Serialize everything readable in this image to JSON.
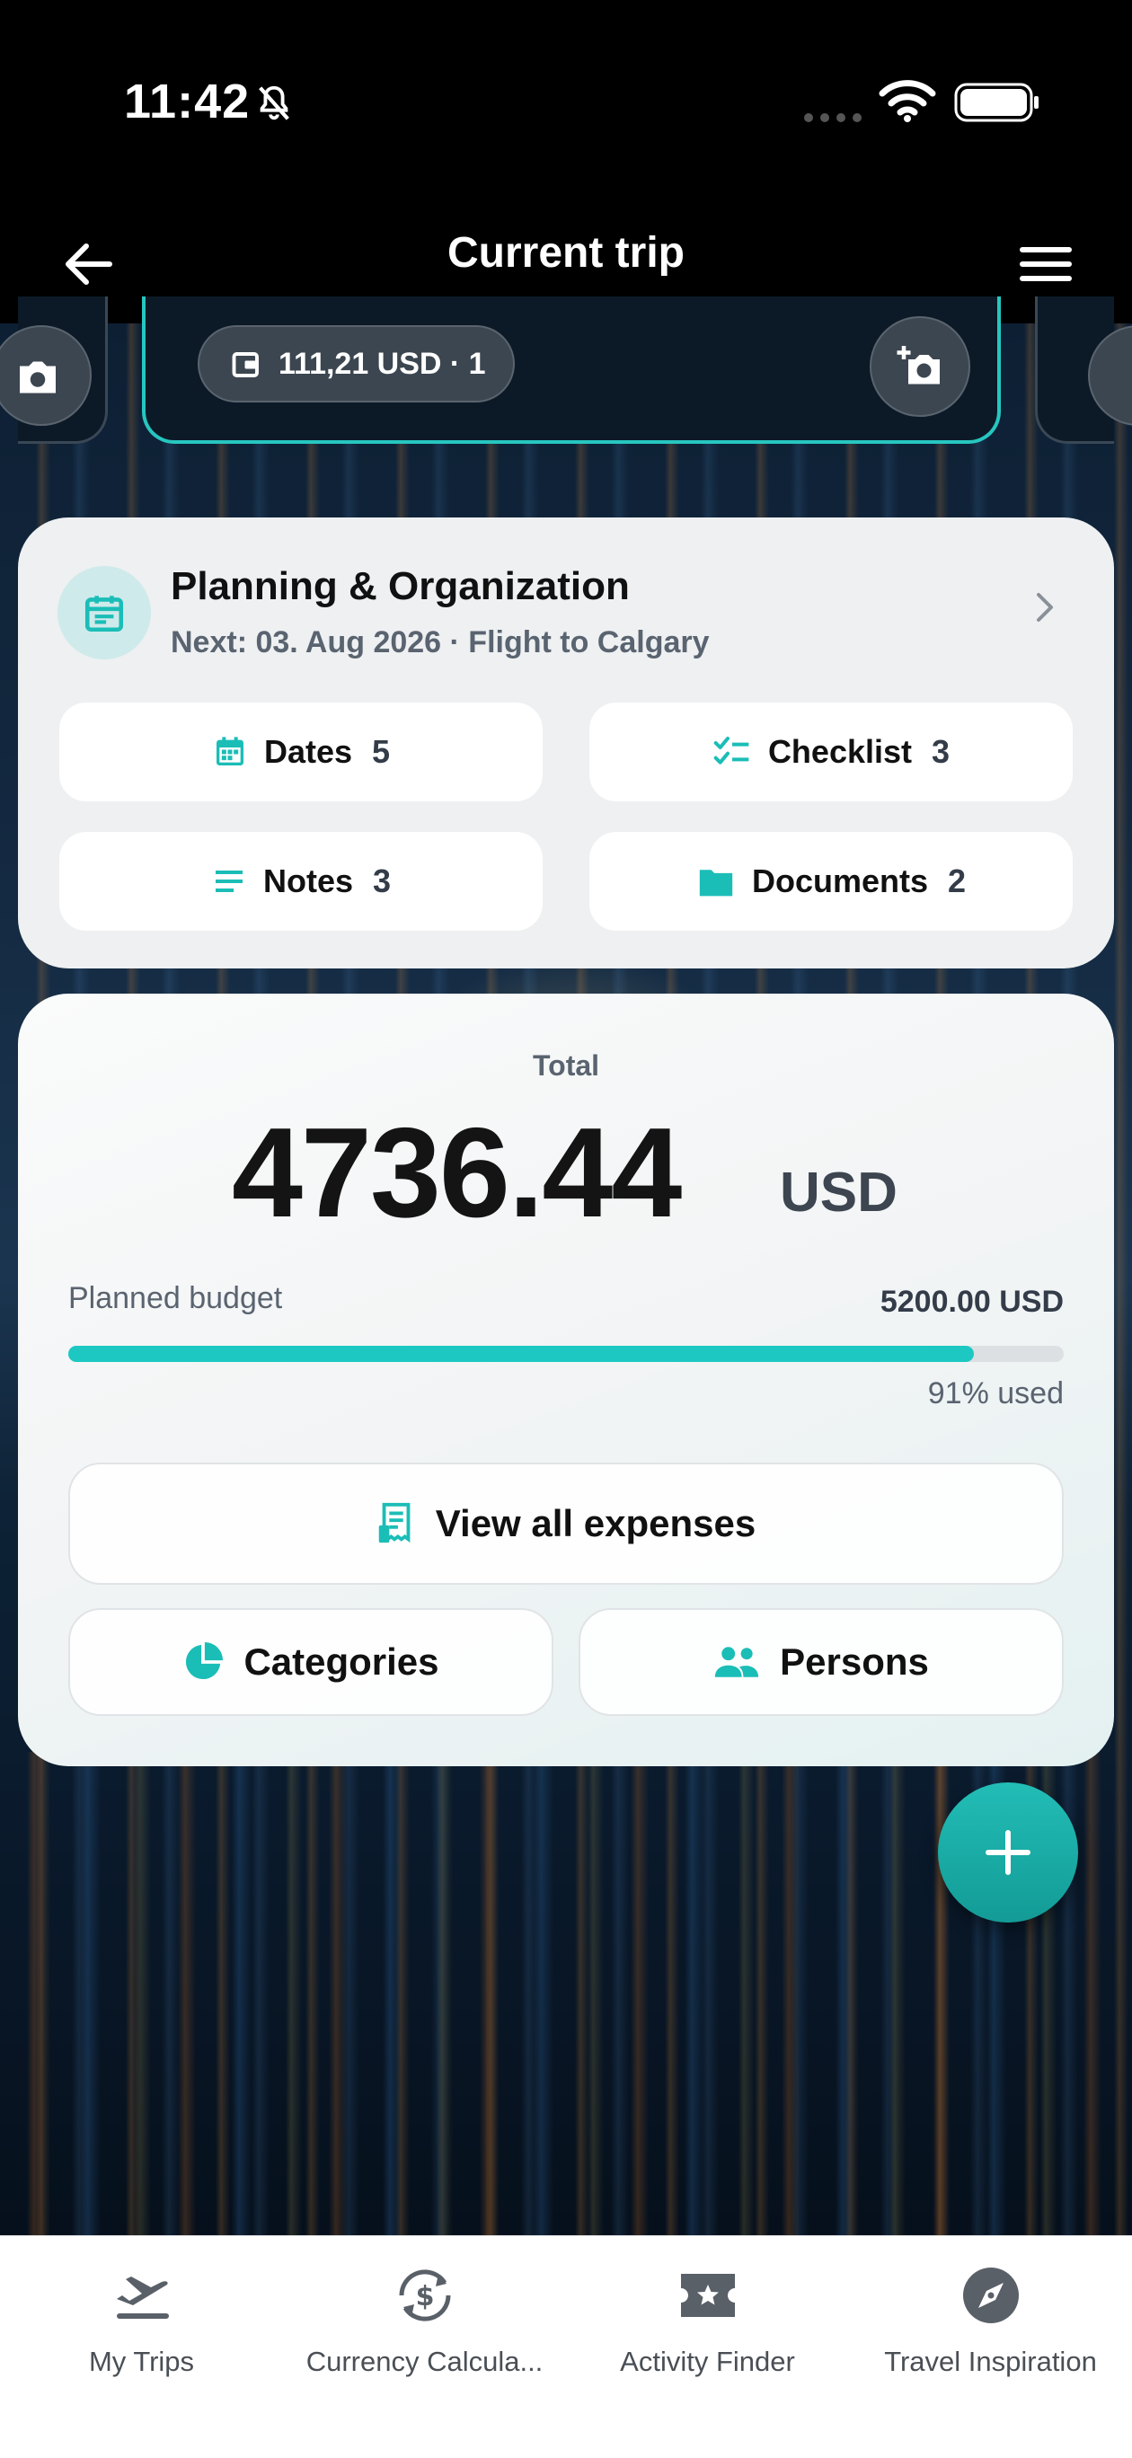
{
  "status_bar": {
    "time": "11:42"
  },
  "header": {
    "title": "Current trip"
  },
  "trip_card": {
    "expense_pill": "111,21 USD · 1"
  },
  "planning": {
    "title": "Planning & Organization",
    "next": "Next: 03. Aug 2026 · Flight to Calgary",
    "buttons": [
      {
        "label": "Dates",
        "count": "5",
        "icon": "calendar-icon"
      },
      {
        "label": "Checklist",
        "count": "3",
        "icon": "checklist-icon"
      },
      {
        "label": "Notes",
        "count": "3",
        "icon": "notes-icon"
      },
      {
        "label": "Documents",
        "count": "2",
        "icon": "folder-icon"
      }
    ]
  },
  "total": {
    "label": "Total",
    "amount": "4736.44",
    "currency": "USD",
    "budget_label": "Planned budget",
    "budget_value": "5200.00 USD",
    "used_fraction": 0.91,
    "used_label": "91% used",
    "view_all": "View all expenses",
    "categories": "Categories",
    "persons": "Persons"
  },
  "colors": {
    "accent": "#1dc8c2",
    "card_bg": "#eef0f2",
    "text_dark": "#111111"
  },
  "bottom_nav": [
    {
      "label": "My Trips",
      "icon": "airplane-departure-icon"
    },
    {
      "label": "Currency Calcula...",
      "icon": "currency-exchange-icon"
    },
    {
      "label": "Activity Finder",
      "icon": "star-ticket-icon"
    },
    {
      "label": "Travel Inspiration",
      "icon": "compass-icon"
    }
  ]
}
